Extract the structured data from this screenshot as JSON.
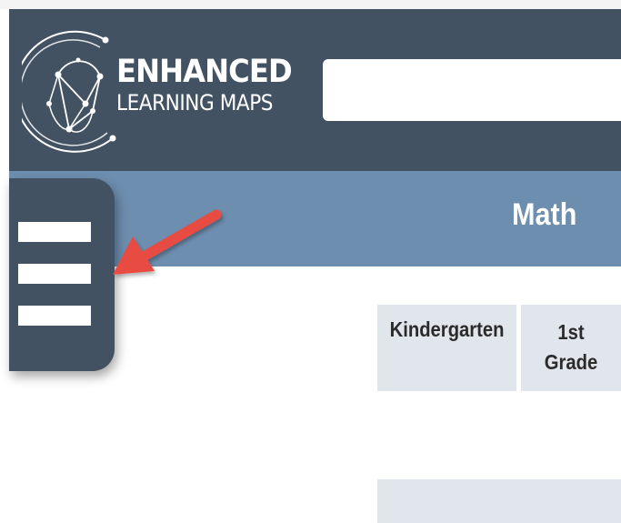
{
  "brand": {
    "line1": "ENHANCED",
    "line2": "LEARNING MAPS"
  },
  "search": {
    "value": "",
    "placeholder": ""
  },
  "subject": {
    "title": "Math"
  },
  "menu": {
    "icon": "hamburger-menu-icon"
  },
  "annotation": {
    "icon": "red-arrow-icon",
    "color": "#e84b43"
  },
  "grades": {
    "kindergarten": "Kindergarten",
    "first_line1": "1st",
    "first_line2": "Grade"
  },
  "colors": {
    "header": "#425263",
    "subject_bar": "#6e8eaf",
    "cell": "#e1e6ec"
  }
}
